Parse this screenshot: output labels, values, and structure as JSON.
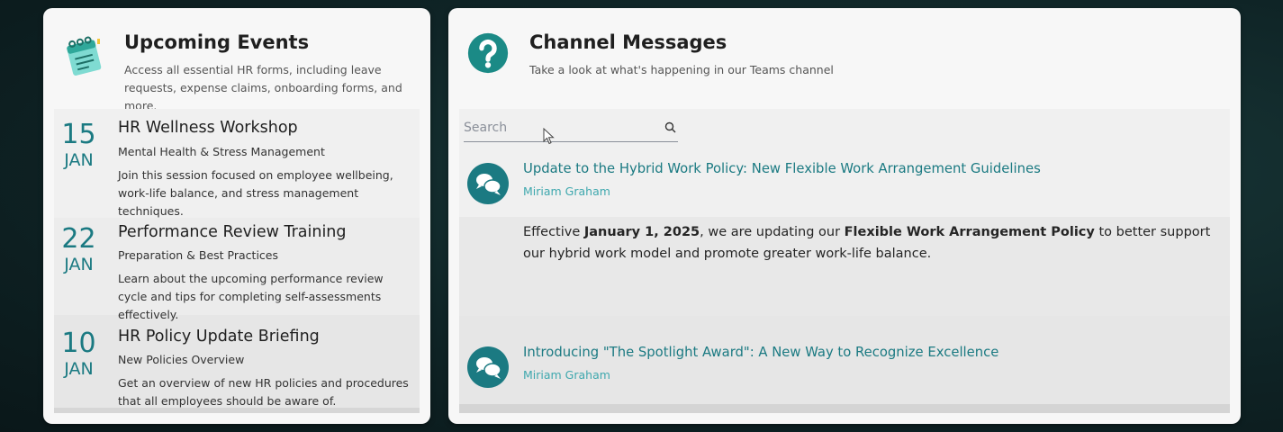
{
  "events": {
    "title": "Upcoming Events",
    "description": "Access all essential HR forms, including leave requests, expense claims, onboarding forms, and more.",
    "icon": "calendar-notepad-icon",
    "items": [
      {
        "day": "15",
        "month": "JAN",
        "title": "HR Wellness Workshop",
        "subtitle": "Mental Health & Stress Management",
        "description": "Join this session focused on employee wellbeing, work-life balance, and stress management techniques."
      },
      {
        "day": "22",
        "month": "JAN",
        "title": "Performance Review Training",
        "subtitle": "Preparation & Best Practices",
        "description": "Learn about the upcoming performance review cycle and tips for completing self-assessments effectively."
      },
      {
        "day": "10",
        "month": "JAN",
        "title": "HR Policy Update Briefing",
        "subtitle": "New Policies Overview",
        "description": "Get an overview of new HR policies and procedures that all employees should be aware of."
      }
    ]
  },
  "messages": {
    "title": "Channel Messages",
    "description": "Take a look at what's happening in our Teams channel",
    "icon": "question-mark-icon",
    "search": {
      "placeholder": "Search",
      "value": ""
    },
    "items": [
      {
        "title": "Update to the Hybrid Work Policy: New Flexible Work Arrangement Guidelines",
        "author": "Miriam Graham",
        "body_parts": [
          "Effective ",
          "January 1, 2025",
          ", we are updating our ",
          "Flexible Work Arrangement Policy",
          " to better support our hybrid work model and promote greater work-life balance."
        ]
      },
      {
        "title": "Introducing \"The Spotlight Award\": A New Way to Recognize Excellence",
        "author": "Miriam Graham"
      }
    ]
  },
  "colors": {
    "accent": "#1b7a82",
    "author": "#3fa8ae",
    "card": "#f7f7f7",
    "row_alt": "#ececec"
  }
}
